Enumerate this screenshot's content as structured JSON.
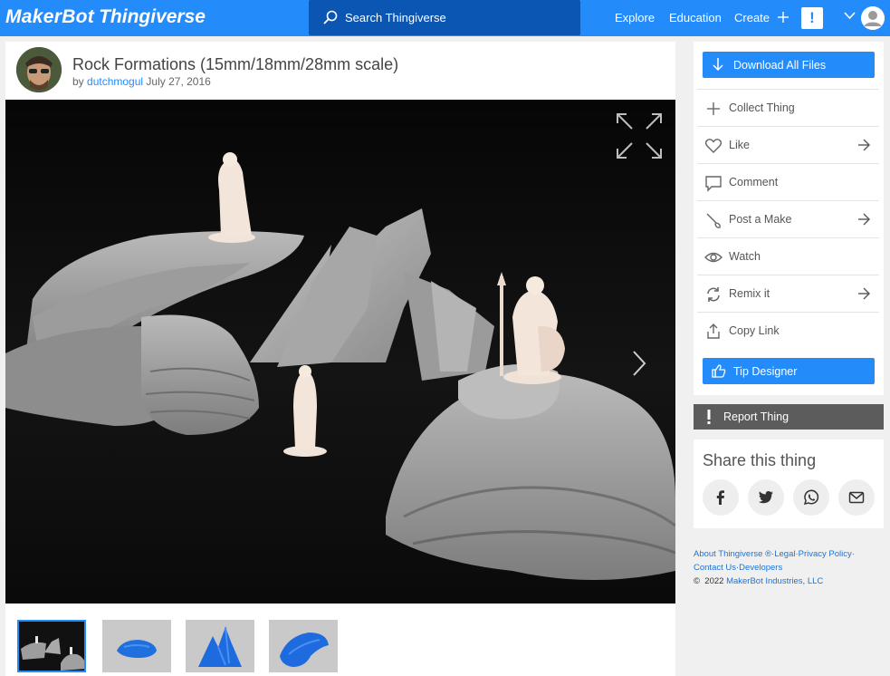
{
  "header": {
    "logo_part1": "MakerBot",
    "logo_part2": "Thingiverse",
    "search_placeholder": "Search Thingiverse",
    "nav_explore": "Explore",
    "nav_education": "Education",
    "nav_create": "Create",
    "alert_glyph": "!",
    "accent_color": "#248bfb"
  },
  "thing": {
    "title": "Rock Formations (15mm/18mm/28mm scale)",
    "by": "by",
    "author": "dutchmogul",
    "date": "July 27, 2016"
  },
  "gallery": {
    "thumbnail_count": 4,
    "selected_index": 0,
    "icons": [
      "expand-icon",
      "next-arrow-icon"
    ]
  },
  "actions": {
    "download_label": "Download All Files",
    "items": [
      {
        "label": "Collect Thing",
        "icon": "plus-icon",
        "has_arrow": false
      },
      {
        "label": "Like",
        "icon": "heart-icon",
        "has_arrow": true
      },
      {
        "label": "Comment",
        "icon": "comment-icon",
        "has_arrow": false
      },
      {
        "label": "Post a Make",
        "icon": "brush-icon",
        "has_arrow": true
      },
      {
        "label": "Watch",
        "icon": "eye-icon",
        "has_arrow": false
      },
      {
        "label": "Remix it",
        "icon": "remix-icon",
        "has_arrow": true
      },
      {
        "label": "Copy Link",
        "icon": "share-icon",
        "has_arrow": false
      }
    ],
    "tip_label": "Tip Designer",
    "report_label": "Report Thing"
  },
  "share": {
    "heading": "Share this thing",
    "networks": [
      "facebook-icon",
      "twitter-icon",
      "whatsapp-icon",
      "email-icon"
    ]
  },
  "footer": {
    "about": "About Thingiverse",
    "registered": "®",
    "legal": "Legal",
    "privacy": "Privacy Policy",
    "contact": "Contact Us",
    "developers": "Developers",
    "copyright_symbol": "©",
    "copyright_year": "2022",
    "company": "MakerBot Industries, LLC"
  }
}
